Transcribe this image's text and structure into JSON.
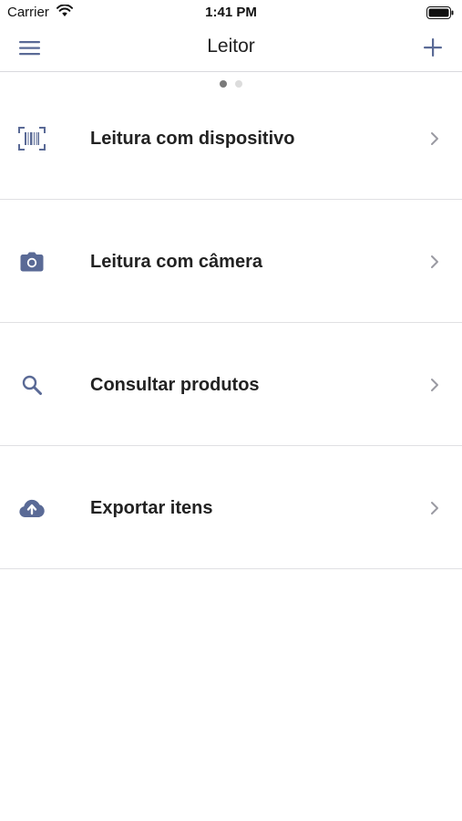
{
  "status_bar": {
    "carrier": "Carrier",
    "time": "1:41 PM"
  },
  "nav": {
    "title": "Leitor",
    "menu_icon": "hamburger-menu-icon",
    "add_icon": "plus-icon"
  },
  "pager": {
    "page_count": 2,
    "active_page": 1
  },
  "menu": {
    "items": [
      {
        "label": "Leitura com dispositivo",
        "icon": "barcode-scan-icon"
      },
      {
        "label": "Leitura com câmera",
        "icon": "camera-icon"
      },
      {
        "label": "Consultar produtos",
        "icon": "search-icon"
      },
      {
        "label": "Exportar itens",
        "icon": "cloud-upload-icon"
      }
    ]
  },
  "colors": {
    "accent": "#5a6a96",
    "text": "#222222",
    "divider": "#e0e0e3",
    "chevron": "#9a9aa2"
  }
}
